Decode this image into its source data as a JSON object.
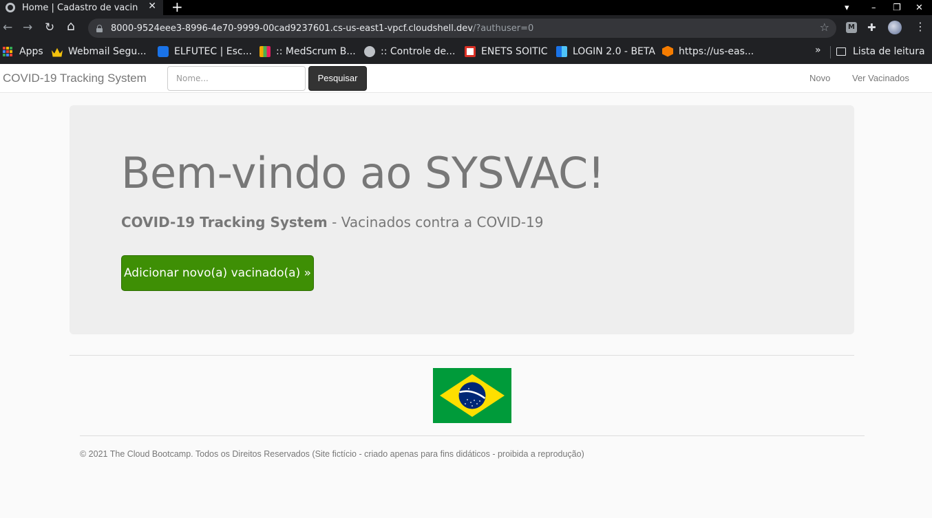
{
  "browser": {
    "tab_title": "Home | Cadastro de vacin",
    "tab_close": "✕",
    "new_tab": "+",
    "window_controls": [
      "▾",
      "–",
      "❐",
      "✕"
    ],
    "nav": {
      "back": "←",
      "forward": "→",
      "reload": "↻",
      "home": "⌂"
    },
    "url_main": "8000-9524eee3-8996-4e70-9999-00cad9237601.cs-us-east1-vpcf.cloudshell.dev",
    "url_rest": "/?authuser=0",
    "star": "☆",
    "ext_letter": "M",
    "puzzle": "✚",
    "menu": "⋮",
    "bookmarks": [
      {
        "label": "Apps",
        "color": "#e8eaed"
      },
      {
        "label": "Webmail Segu...",
        "color": "#f4c20d"
      },
      {
        "label": "ELFUTEC | Esc...",
        "color": "#1a73e8"
      },
      {
        "label": ":: MedScrum B...",
        "color": "#f2a900"
      },
      {
        "label": ":: Controle de...",
        "color": "#bdc1c6"
      },
      {
        "label": "ENETS SOITIC",
        "color": "#d93025"
      },
      {
        "label": "LOGIN 2.0 - BETA",
        "color": "#1a73e8"
      },
      {
        "label": "https://us-eas...",
        "color": "#f57c00"
      }
    ],
    "bookmarks_more": "»",
    "reading_list": "Lista de leitura"
  },
  "navbar": {
    "brand": "COVID-19 Tracking System",
    "search_placeholder": "Nome...",
    "search_button": "Pesquisar",
    "links": [
      "Novo",
      "Ver Vacinados"
    ]
  },
  "jumbotron": {
    "title": "Bem-vindo ao SYSVAC!",
    "subtitle_bold": "COVID-19 Tracking System",
    "subtitle_rest": " - Vacinados contra a COVID-19",
    "button": "Adicionar novo(a) vacinado(a) »"
  },
  "footer": {
    "text": "© 2021 The Cloud Bootcamp. Todos os Direitos Reservados (Site fictício - criado apenas para fins didáticos - proibida a reprodução)"
  },
  "colors": {
    "cta_green": "#3e8f05",
    "flag_green": "#009b3a",
    "flag_yellow": "#fedf00",
    "flag_blue": "#002776"
  }
}
